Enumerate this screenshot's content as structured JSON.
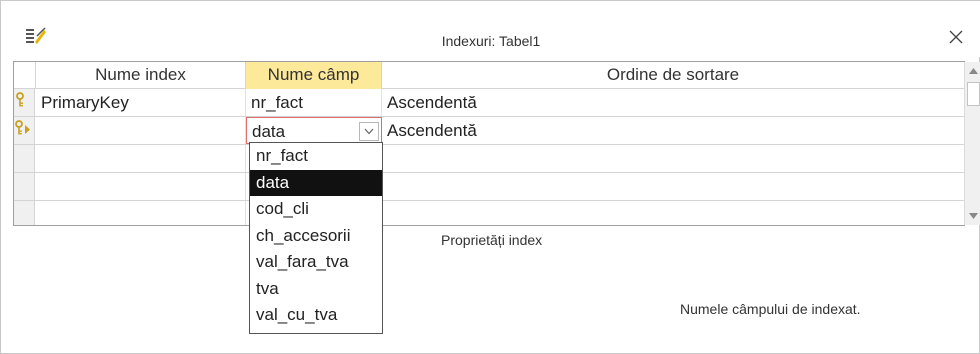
{
  "window": {
    "title": "Indexuri: Tabel1"
  },
  "columns": {
    "index_name": "Nume index",
    "field_name": "Nume câmp",
    "sort_order": "Ordine de sortare"
  },
  "rows": [
    {
      "index_name": "PrimaryKey",
      "field_name": "nr_fact",
      "sort_order": "Ascendentă",
      "selector": "key-icon"
    },
    {
      "index_name": "",
      "field_name": "data",
      "sort_order": "Ascendentă",
      "selector": "key-current-record-icon"
    },
    {
      "index_name": "",
      "field_name": "",
      "sort_order": ""
    },
    {
      "index_name": "",
      "field_name": "",
      "sort_order": ""
    },
    {
      "index_name": "",
      "field_name": "",
      "sort_order": ""
    }
  ],
  "dropdown": {
    "options": [
      "nr_fact",
      "data",
      "cod_cli",
      "ch_accesorii",
      "val_fara_tva",
      "tva",
      "val_cu_tva"
    ],
    "selected": "data"
  },
  "properties": {
    "label": "Proprietăți index",
    "help_text": "Numele câmpului de indexat."
  },
  "colors": {
    "active_header": "#fde99a",
    "focus_border": "#e06b6b",
    "selected_option": "#111111",
    "key_icon": "#c8a020"
  }
}
